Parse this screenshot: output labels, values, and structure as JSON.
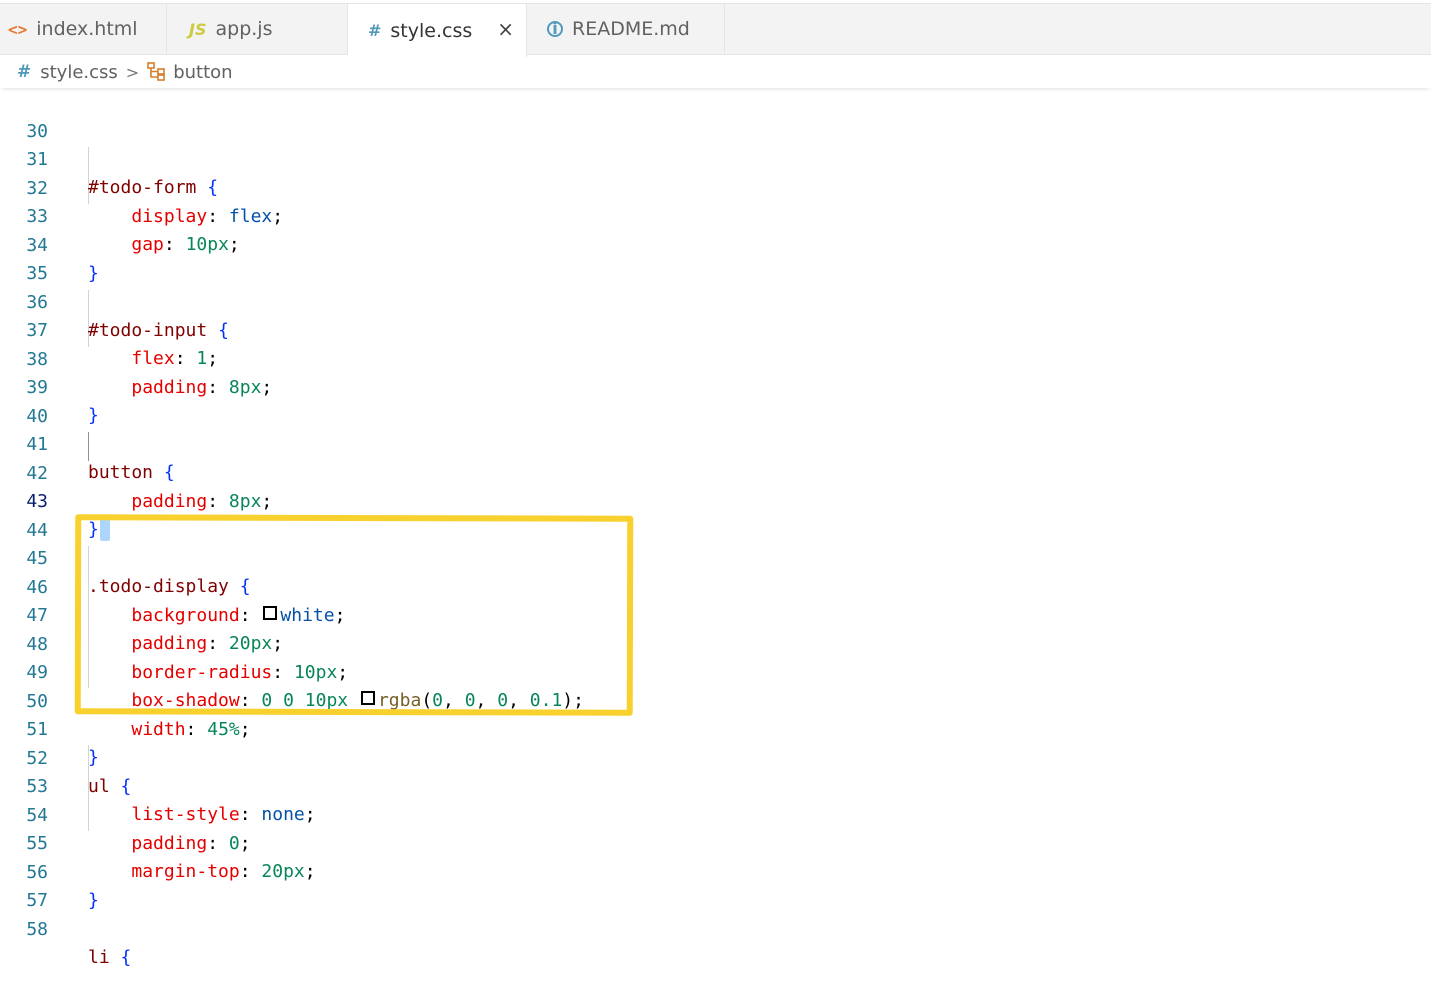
{
  "tabs": [
    {
      "icon": "<>",
      "label": "index.html"
    },
    {
      "icon": "JS",
      "label": "app.js"
    },
    {
      "icon": "#",
      "label": "style.css",
      "close": "×"
    },
    {
      "icon": "i",
      "label": "README.md"
    }
  ],
  "breadcrumb": {
    "file_icon": "#",
    "file": "style.css",
    "separator": ">",
    "symbol": "button"
  },
  "code": {
    "line_numbers": [
      "30",
      "31",
      "32",
      "33",
      "34",
      "35",
      "36",
      "37",
      "38",
      "39",
      "40",
      "41",
      "42",
      "43",
      "44",
      "45",
      "46",
      "47",
      "48",
      "49",
      "50",
      "51",
      "52",
      "53",
      "54",
      "55",
      "56",
      "57",
      "58"
    ],
    "current_line": "43",
    "l31": {
      "sel": "#todo-form",
      "brace": "{"
    },
    "l32": {
      "prop": "display",
      "val": "flex"
    },
    "l33": {
      "prop": "gap",
      "val": "10px"
    },
    "l34": {
      "brace": "}"
    },
    "l36": {
      "sel": "#todo-input",
      "brace": "{"
    },
    "l37": {
      "prop": "flex",
      "val": "1"
    },
    "l38": {
      "prop": "padding",
      "val": "8px"
    },
    "l39": {
      "brace": "}"
    },
    "l41": {
      "sel": "button",
      "brace": "{"
    },
    "l42": {
      "prop": "padding",
      "val": "8px"
    },
    "l43": {
      "brace": "}"
    },
    "l45": {
      "sel": ".todo-display",
      "brace": "{"
    },
    "l46": {
      "prop": "background",
      "val": "white"
    },
    "l47": {
      "prop": "padding",
      "val": "20px"
    },
    "l48": {
      "prop": "border-radius",
      "val": "10px"
    },
    "l49": {
      "prop": "box-shadow",
      "val1": "0 0 10px",
      "fn": "rgba",
      "a1": "0",
      "a2": "0",
      "a3": "0",
      "a4": "0.1"
    },
    "l50": {
      "prop": "width",
      "val": "45%"
    },
    "l51": {
      "brace": "}"
    },
    "l52": {
      "sel": "ul",
      "brace": "{"
    },
    "l53": {
      "prop": "list-style",
      "val": "none"
    },
    "l54": {
      "prop": "padding",
      "val": "0"
    },
    "l55": {
      "prop": "margin-top",
      "val": "20px"
    },
    "l56": {
      "brace": "}"
    },
    "l58": {
      "sel": "li",
      "brace": "{"
    }
  },
  "colors": {
    "highlight_box": "#f8d12f",
    "selector": "#800000",
    "property": "#e50000",
    "number": "#098658",
    "keyword_value": "#0451a5",
    "brace": "#0431fa"
  }
}
